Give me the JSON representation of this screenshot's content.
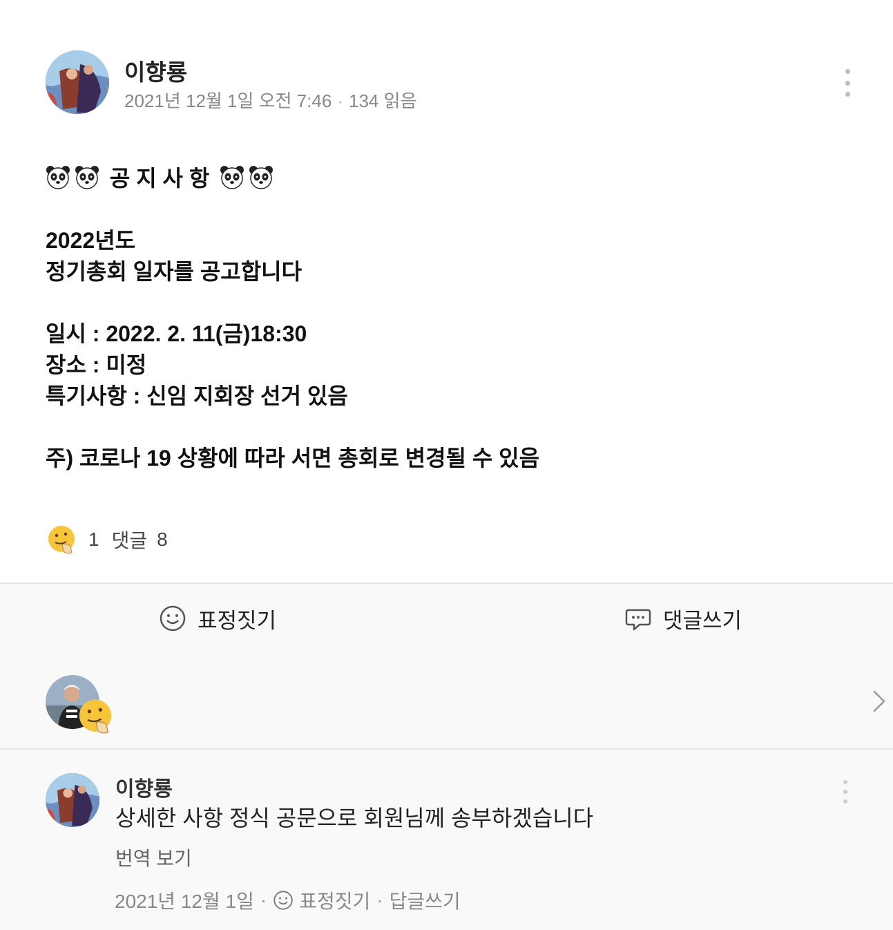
{
  "post": {
    "author": "이향룡",
    "date": "2021년 12월 1일 오전 7:46",
    "reads": "134 읽음",
    "title_text": "공 지 사 항",
    "body_lines": [
      "2022년도",
      "정기총회 일자를 공고합니다",
      "일시 : 2022. 2. 11(금)18:30",
      "장소 : 미정",
      "특기사항 : 신임 지회장 선거 있음",
      "주) 코로나 19 상황에 따라 서면 총회로 변경될 수 있음"
    ]
  },
  "reactions": {
    "count": "1",
    "comment_label": "댓글",
    "comment_count": "8"
  },
  "actions": {
    "react_label": "표정짓기",
    "comment_label": "댓글쓰기"
  },
  "comment": {
    "author": "이향룡",
    "text": "상세한 사항 정식 공문으로 회원님께 송부하겠습니다",
    "translate_label": "번역 보기",
    "date": "2021년 12월 1일",
    "react_label": "표정짓기",
    "reply_label": "답글쓰기"
  },
  "icons": {
    "panda": "panda-face-icon",
    "reaction": "thinking-face-icon",
    "smile": "smile-icon",
    "speech": "speech-bubble-icon",
    "more": "more-vertical-icon",
    "chevron": "chevron-right-icon"
  },
  "colors": {
    "muted": "#888888",
    "bar_bg": "#f9f9f9",
    "divider": "#e6e6e6"
  }
}
